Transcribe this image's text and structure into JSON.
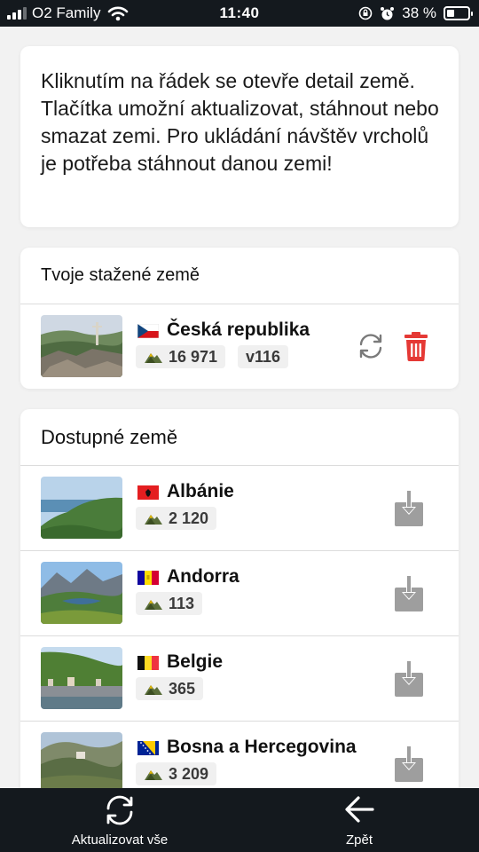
{
  "status_bar": {
    "carrier": "O2 Family",
    "time": "11:40",
    "battery": "38 %",
    "battery_level": 0.38,
    "icons": [
      "signal-icon",
      "wifi-icon",
      "screen-lock-icon",
      "alarm-icon",
      "battery-icon"
    ]
  },
  "info": {
    "text": "Kliknutím na řádek se otevře detail země. Tlačítka umožní aktualizovat, stáhnout nebo smazat zemi. Pro ukládání návštěv vrcholů je potřeba stáhnout danou zemi!"
  },
  "downloaded": {
    "title": "Tvoje stažené země",
    "items": [
      {
        "name": "Česká republika",
        "peaks": "16 971",
        "version": "v116",
        "flag": "cz"
      }
    ]
  },
  "available": {
    "title": "Dostupné země",
    "items": [
      {
        "name": "Albánie",
        "peaks": "2 120",
        "flag": "al"
      },
      {
        "name": "Andorra",
        "peaks": "113",
        "flag": "ad"
      },
      {
        "name": "Belgie",
        "peaks": "365",
        "flag": "be"
      },
      {
        "name": "Bosna a Hercegovina",
        "peaks": "3 209",
        "flag": "ba"
      }
    ]
  },
  "bottom_bar": {
    "update_all_label": "Aktualizovat vše",
    "back_label": "Zpět"
  },
  "colors": {
    "bar_background": "#14191e",
    "delete_red": "#e53935",
    "download_gray": "#9e9e9e",
    "refresh_gray": "#7a7a7a"
  }
}
